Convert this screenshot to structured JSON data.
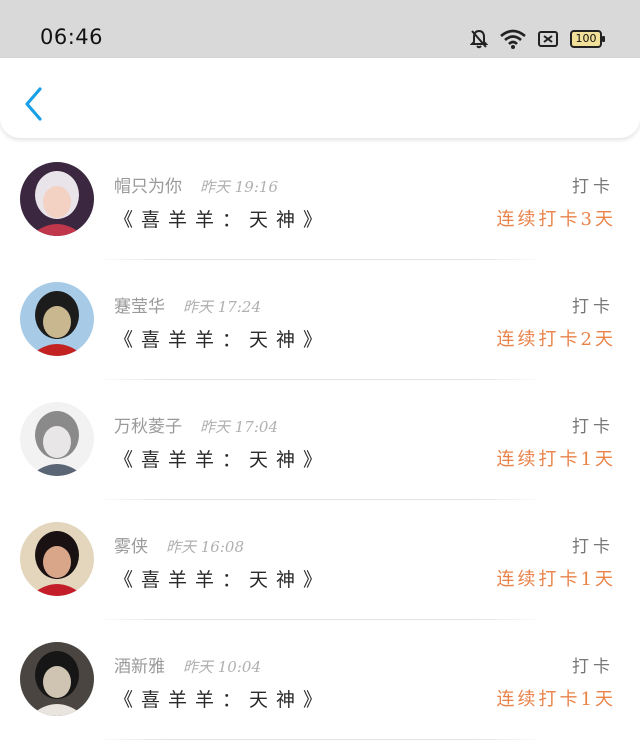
{
  "status_bar": {
    "time": "06:46",
    "battery": "100",
    "icons": [
      "bell-off-icon",
      "wifi-icon",
      "sim-off-icon",
      "battery-icon"
    ]
  },
  "nav": {
    "back_icon": "chevron-left-icon",
    "accent_color": "#1aa0e6"
  },
  "entries": [
    {
      "name": "帽只为你",
      "time": "昨天 19:16",
      "title": "《喜羊羊：天神》",
      "label": "打卡",
      "streak": "连续打卡3天",
      "avatar": {
        "bg": "#3b2740",
        "hair": "#e9e3ea",
        "face": "#f3d2c4",
        "accent": "#c0364b"
      }
    },
    {
      "name": "蹇莹华",
      "time": "昨天 17:24",
      "title": "《喜羊羊：天神》",
      "label": "打卡",
      "streak": "连续打卡2天",
      "avatar": {
        "bg": "#a7cbe6",
        "hair": "#1c1c1c",
        "face": "#c9b78f",
        "accent": "#c22222"
      }
    },
    {
      "name": "万秋菱子",
      "time": "昨天 17:04",
      "title": "《喜羊羊：天神》",
      "label": "打卡",
      "streak": "连续打卡1天",
      "avatar": {
        "bg": "#f2f2f2",
        "hair": "#8a8a8a",
        "face": "#e8e6e6",
        "accent": "#5a6575"
      }
    },
    {
      "name": "雾侠",
      "time": "昨天 16:08",
      "title": "《喜羊羊：天神》",
      "label": "打卡",
      "streak": "连续打卡1天",
      "avatar": {
        "bg": "#e3d6bd",
        "hair": "#1a1212",
        "face": "#d9a68a",
        "accent": "#c31d2a"
      }
    },
    {
      "name": "酒新雅",
      "time": "昨天 10:04",
      "title": "《喜羊羊：天神》",
      "label": "打卡",
      "streak": "连续打卡1天",
      "avatar": {
        "bg": "#4a4540",
        "hair": "#161616",
        "face": "#cfc3b2",
        "accent": "#e9e5de"
      }
    }
  ]
}
